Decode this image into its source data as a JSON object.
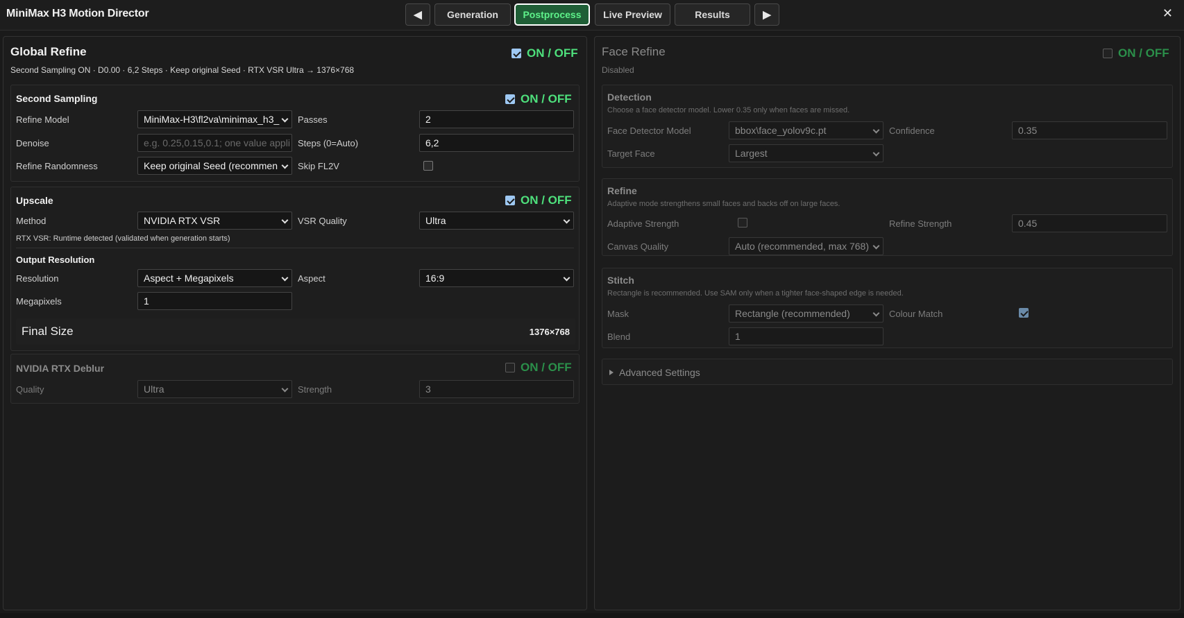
{
  "app": {
    "title": "MiniMax H3 Motion Director"
  },
  "nav": {
    "prev_icon": "◀",
    "next_icon": "▶",
    "tabs": [
      "Generation",
      "Postprocess",
      "Live Preview",
      "Results"
    ],
    "active_tab": "Postprocess",
    "close_icon": "✕"
  },
  "onoff_label": "ON / OFF",
  "global_refine": {
    "title": "Global Refine",
    "enabled": true,
    "summary": "Second Sampling ON · D0.00 · 6,2 Steps · Keep original Seed · RTX VSR Ultra → 1376×768",
    "second_sampling": {
      "title": "Second Sampling",
      "enabled": true,
      "refine_model_label": "Refine Model",
      "refine_model_value": "MiniMax-H3\\fl2va\\minimax_h3_",
      "passes_label": "Passes",
      "passes_value": "2",
      "denoise_label": "Denoise",
      "denoise_placeholder": "e.g. 0.25,0.15,0.1; one value appli",
      "steps_label": "Steps (0=Auto)",
      "steps_value": "6,2",
      "randomness_label": "Refine Randomness",
      "randomness_value": "Keep original Seed (recommen",
      "skip_label": "Skip FL2V",
      "skip_checked": false
    },
    "upscale": {
      "title": "Upscale",
      "enabled": true,
      "method_label": "Method",
      "method_value": "NVIDIA RTX VSR",
      "vsr_quality_label": "VSR Quality",
      "vsr_quality_value": "Ultra",
      "note": "RTX VSR: Runtime detected (validated when generation starts)",
      "output_title": "Output Resolution",
      "resolution_label": "Resolution",
      "resolution_value": "Aspect + Megapixels",
      "aspect_label": "Aspect",
      "aspect_value": "16:9",
      "megapixels_label": "Megapixels",
      "megapixels_value": "1",
      "final_size_label": "Final Size",
      "final_size_value": "1376×768"
    },
    "deblur": {
      "title": "NVIDIA RTX Deblur",
      "enabled": false,
      "quality_label": "Quality",
      "quality_value": "Ultra",
      "strength_label": "Strength",
      "strength_value": "3"
    }
  },
  "face_refine": {
    "title": "Face Refine",
    "enabled": false,
    "status": "Disabled",
    "detection": {
      "title": "Detection",
      "desc": "Choose a face detector model. Lower 0.35 only when faces are missed.",
      "model_label": "Face Detector Model",
      "model_value": "bbox\\face_yolov9c.pt",
      "confidence_label": "Confidence",
      "confidence_value": "0.35",
      "target_label": "Target Face",
      "target_value": "Largest"
    },
    "refine": {
      "title": "Refine",
      "desc": "Adaptive mode strengthens small faces and backs off on large faces.",
      "adaptive_label": "Adaptive Strength",
      "adaptive_checked": false,
      "strength_label": "Refine Strength",
      "strength_value": "0.45",
      "canvas_label": "Canvas Quality",
      "canvas_value": "Auto (recommended, max 768)"
    },
    "stitch": {
      "title": "Stitch",
      "desc": "Rectangle is recommended. Use SAM only when a tighter face-shaped edge is needed.",
      "mask_label": "Mask",
      "mask_value": "Rectangle (recommended)",
      "colour_label": "Colour Match",
      "colour_checked": true,
      "blend_label": "Blend",
      "blend_value": "1"
    },
    "advanced_label": "Advanced Settings"
  },
  "colors": {
    "accent_green": "#4ee07c",
    "active_tab_bg": "#1f5e36",
    "checkbox_blue": "#9ec8f2",
    "background": "#1a1a1a"
  }
}
